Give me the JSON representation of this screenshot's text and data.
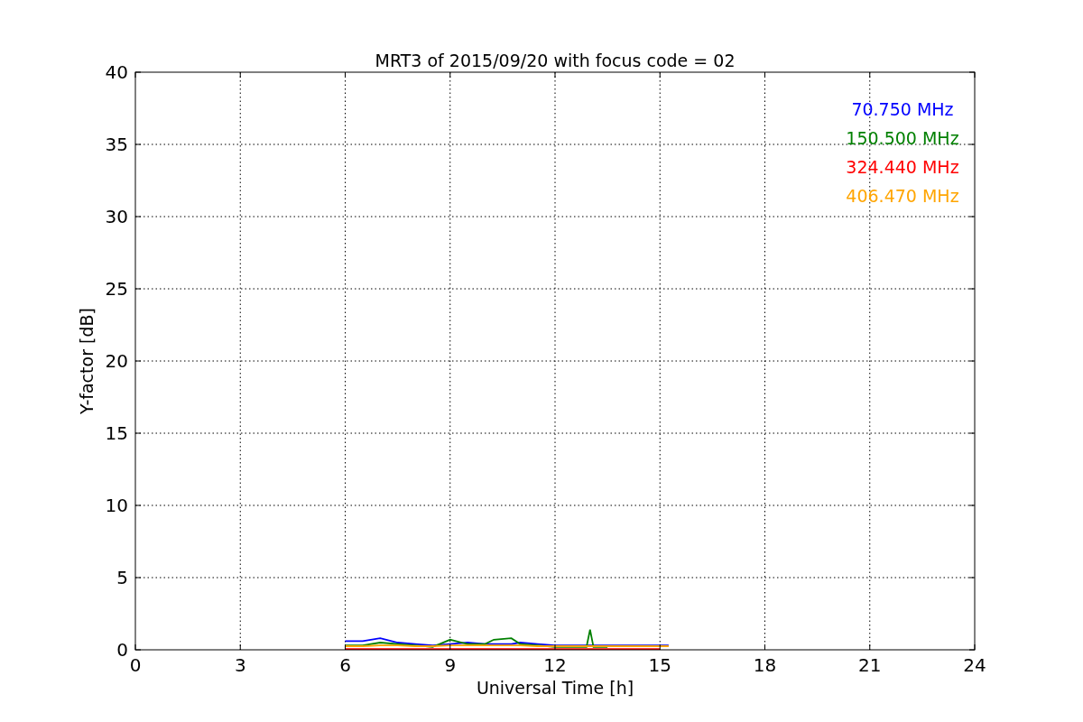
{
  "plot": {
    "chart_data": {
      "type": "line",
      "title": "MRT3 of 2015/09/20 with focus code = 02",
      "xlabel": "Universal Time [h]",
      "ylabel": "Y-factor [dB]",
      "x": [
        6,
        6.5,
        7,
        7.5,
        8,
        8.5,
        9,
        9.5,
        10,
        10.25,
        10.75,
        11,
        11.5,
        12,
        12.5,
        12.9,
        13,
        13.1,
        13.5,
        14,
        14.5,
        15,
        15.25
      ],
      "series": [
        {
          "name": "70.750 MHz",
          "color": "#0000ff",
          "values": [
            0.6,
            0.6,
            0.8,
            0.5,
            0.4,
            0.3,
            0.4,
            0.5,
            0.4,
            0.4,
            0.4,
            0.5,
            0.4,
            0.3,
            0.3,
            0.3,
            0.3,
            0.3,
            0.3,
            0.3,
            0.3,
            0.3,
            0.3
          ]
        },
        {
          "name": "150.500 MHz",
          "color": "#008000",
          "values": [
            0.3,
            0.3,
            0.5,
            0.4,
            0.3,
            0.2,
            0.7,
            0.4,
            0.4,
            0.7,
            0.8,
            0.4,
            0.3,
            0.2,
            0.2,
            0.2,
            1.4,
            0.2,
            0.2,
            null,
            null,
            null,
            null
          ]
        },
        {
          "name": "324.440 MHz",
          "color": "#ff0000",
          "values": [
            0.05,
            0.05,
            0.05,
            0.05,
            0.05,
            0.05,
            0.05,
            0.05,
            0.05,
            0.05,
            0.05,
            0.05,
            0.05,
            0.05,
            0.05,
            0.05,
            0.05,
            0.05,
            0.05,
            0.05,
            0.05,
            0.05,
            null
          ]
        },
        {
          "name": "406.470 MHz",
          "color": "#ffa500",
          "values": [
            0.25,
            0.25,
            0.3,
            0.3,
            0.25,
            0.25,
            0.3,
            0.3,
            0.3,
            0.3,
            0.3,
            0.3,
            0.25,
            0.25,
            0.25,
            0.25,
            0.25,
            0.25,
            0.25,
            0.25,
            0.25,
            0.25,
            0.25
          ]
        }
      ],
      "grid": true,
      "xlim": [
        0,
        24
      ],
      "ylim": [
        0,
        40
      ],
      "xticks": [
        0,
        3,
        6,
        9,
        12,
        15,
        18,
        21,
        24
      ],
      "yticks": [
        0,
        5,
        10,
        15,
        20,
        25,
        30,
        35,
        40
      ]
    }
  }
}
